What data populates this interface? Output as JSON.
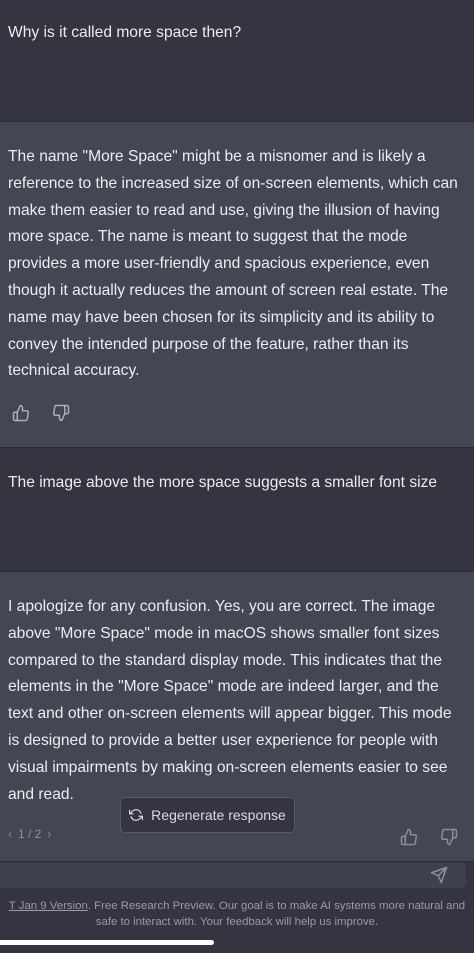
{
  "conversation": {
    "user_1": "Why is it called more space then?",
    "assistant_1": "The name \"More Space\" might be a misnomer and is likely a reference to the increased size of on-screen elements, which can make them easier to read and use, giving the illusion of having more space. The name is meant to suggest that the mode provides a more user-friendly and spacious experience, even though it actually reduces the amount of screen real estate. The name may have been chosen for its simplicity and its ability to convey the intended purpose of the feature, rather than its technical accuracy.",
    "user_2": "The image above the more space suggests a smaller font size",
    "assistant_2": "I apologize for any confusion. Yes, you are correct. The image above \"More Space\" mode in macOS shows smaller font sizes compared to the standard display mode. This indicates that the elements in the \"More Space\" mode are indeed larger, and the text and other on-screen elements will appear bigger. This mode is designed to provide a better user experience for people with visual impairments by making on-screen elements easier to see and read."
  },
  "pager": {
    "prev": "‹",
    "label": "1 / 2",
    "next": "›"
  },
  "regenerate_label": "Regenerate response",
  "input": {
    "value": "",
    "placeholder": ""
  },
  "footer": {
    "link_text": "T Jan 9 Version",
    "text": ". Free Research Preview. Our goal is to make AI systems more natural and safe to interact with. Your feedback will help us improve."
  },
  "icons": {
    "thumbs_up": "thumbs-up-icon",
    "thumbs_down": "thumbs-down-icon",
    "regenerate": "refresh-icon",
    "send": "send-icon"
  },
  "colors": {
    "user_bg": "#343541",
    "assistant_bg": "#444654",
    "text": "#ececf1",
    "muted": "#8e8ea0"
  }
}
